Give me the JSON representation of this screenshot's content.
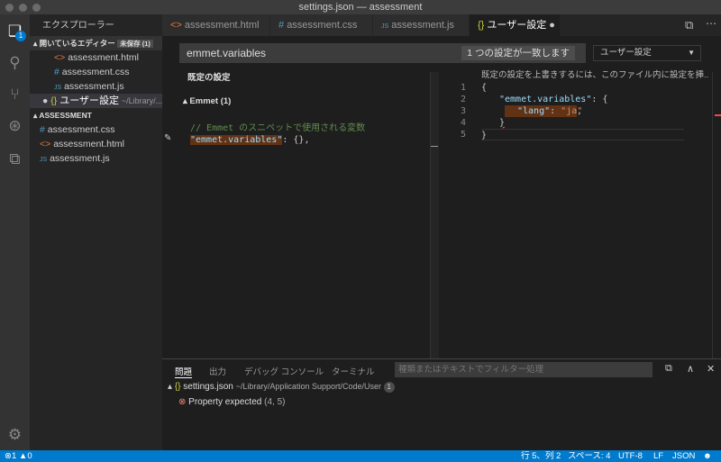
{
  "window": {
    "title": "settings.json — assessment"
  },
  "activity_bar": {
    "explorer_badge": "1"
  },
  "sidebar": {
    "title": "エクスプローラー",
    "open_editors": {
      "label": "開いているエディター",
      "badge": "未保存 (1)",
      "items": [
        {
          "icon": "html-icon",
          "glyph": "<>",
          "label": "assessment.html"
        },
        {
          "icon": "css-icon",
          "glyph": "#",
          "label": "assessment.css"
        },
        {
          "icon": "js-icon",
          "glyph": "JS",
          "label": "assessment.js"
        }
      ],
      "dirty_item": {
        "glyph": "{}",
        "label": "ユーザー設定",
        "path": "~/Library/..."
      }
    },
    "folder": {
      "label": "ASSESSMENT",
      "items": [
        {
          "icon": "css-icon",
          "glyph": "#",
          "label": "assessment.css"
        },
        {
          "icon": "html-icon",
          "glyph": "<>",
          "label": "assessment.html"
        },
        {
          "icon": "js-icon",
          "glyph": "JS",
          "label": "assessment.js"
        }
      ]
    }
  },
  "tabs": [
    {
      "glyph": "<>",
      "label": "assessment.html"
    },
    {
      "glyph": "#",
      "label": "assessment.css"
    },
    {
      "glyph": "JS",
      "label": "assessment.js"
    },
    {
      "glyph": "{}",
      "label": "ユーザー設定",
      "dirty": "●"
    }
  ],
  "settings": {
    "search_value": "emmet.variables",
    "match_count": "1 つの設定が一致します",
    "scope_dropdown": "ユーザー設定",
    "default_header": "既定の設定",
    "group": "Emmet (1)",
    "default_comment": "// Emmet のスニペットで使用される変数",
    "default_key": "\"emmet.variables\"",
    "default_rest": ": {},",
    "hint": "既定の設定を上書きするには、このファイル内に設定を挿..."
  },
  "user_code": {
    "line_numbers": [
      "1",
      "2",
      "3",
      "4",
      "5"
    ],
    "l1": "{",
    "l2_key": "\"emmet.variables\"",
    "l2_rest": ": {",
    "l3_key": "\"lang\"",
    "l3_colon": ": ",
    "l3_val": "\"ja\"",
    "l3_rest": ",",
    "l4": "}",
    "l5": "}"
  },
  "panel": {
    "tabs": [
      "問題",
      "出力",
      "デバッグ コンソール",
      "ターミナル"
    ],
    "filter_placeholder": "種類またはテキストでフィルター処理",
    "file": {
      "glyph": "{}",
      "name": "settings.json",
      "path": "~/Library/Application Support/Code/User",
      "count": "1"
    },
    "problem": {
      "message": "Property expected",
      "location": "(4, 5)"
    }
  },
  "status_bar": {
    "errors": "1",
    "warnings": "0",
    "position": "行 5、列 2",
    "spaces": "スペース: 4",
    "encoding": "UTF-8",
    "eol": "LF",
    "language": "JSON"
  }
}
